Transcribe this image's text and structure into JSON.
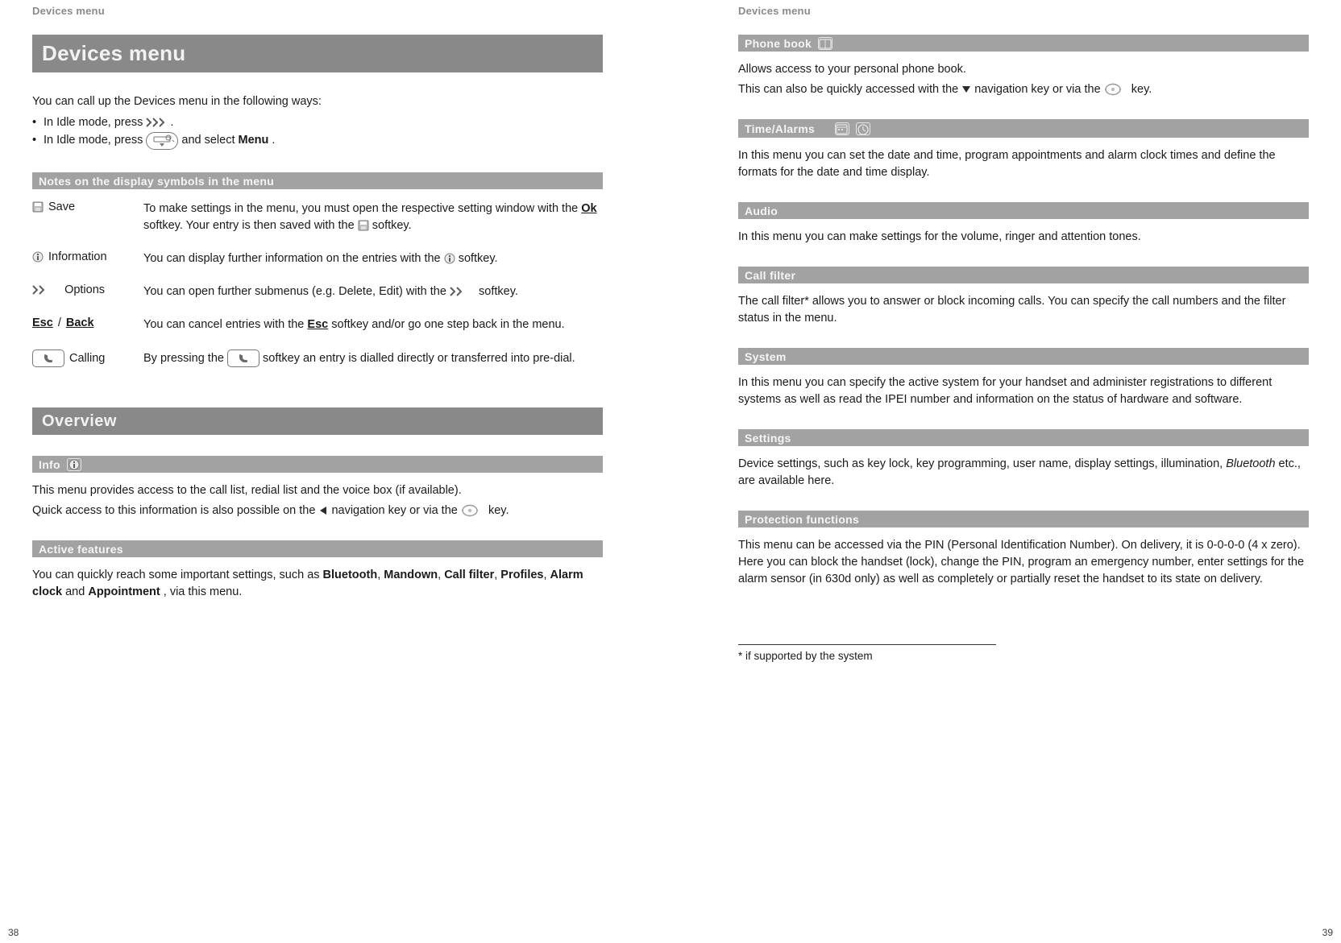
{
  "page_left": {
    "running_head": "Devices menu",
    "title": "Devices menu",
    "intro": "You can call up the Devices menu in the following ways:",
    "bullet1_a": "In Idle mode, press ",
    "bullet1_b": " .",
    "bullet2_a": "In Idle mode, press ",
    "bullet2_b": " and select ",
    "bullet2_menu": "Menu",
    "bullet2_c": ".",
    "notes_header": "Notes on the display symbols in the menu",
    "rows": {
      "save": {
        "label": "Save",
        "text_a": "To make settings in the menu, you must open the respective setting window with the ",
        "ok": "Ok",
        "text_b": " softkey. Your entry is then saved with the ",
        "text_c": " softkey."
      },
      "info": {
        "label": "Information",
        "text_a": "You can display further information on the entries with the ",
        "text_b": " softkey."
      },
      "options": {
        "label": "Options",
        "text_a": "You can open further submenus (e.g. Delete, Edit) with the ",
        "text_b": " softkey."
      },
      "esc": {
        "label_a": "Esc",
        "label_sep": " / ",
        "label_b": "Back",
        "text_a": "You can cancel entries with the ",
        "esc2": "Esc",
        "text_b": " softkey and/or go one step back in the menu."
      },
      "call": {
        "label": "Calling",
        "text_a": "By pressing the ",
        "text_b": " softkey an entry is dialled directly or transferred into pre-dial."
      }
    },
    "overview_header": "Overview",
    "info_section": {
      "title": "Info",
      "line1": "This menu provides access to the call list, redial list and the voice box (if available).",
      "line2_a": "Quick access to this information is also possible on the ",
      "line2_b": " navigation key or via the ",
      "line2_c": " key."
    },
    "active_section": {
      "title": "Active features",
      "text_a": "You can quickly reach some important settings, such as ",
      "f1": "Bluetooth",
      "c1": ", ",
      "f2": "Mandown",
      "c2": ", ",
      "f3": "Call filter",
      "c3": ", ",
      "f4": "Profiles",
      "c4": ", ",
      "f5": "Alarm clock",
      "and": " and ",
      "f6": "Appointment",
      "text_b": ", via this menu."
    },
    "page_num": "38"
  },
  "page_right": {
    "running_head": "Devices menu",
    "phone_book": {
      "title": "Phone book",
      "line1": "Allows access to your personal phone book.",
      "line2_a": "This can also be quickly accessed with the ",
      "line2_b": " navigation key or via the ",
      "line2_c": " key."
    },
    "time_alarms": {
      "title": "Time/Alarms",
      "text": "In this menu you can set the date and time, program appointments and alarm clock times and define the formats for the date and time display."
    },
    "audio": {
      "title": "Audio",
      "text": "In this menu you can make settings for the volume, ringer and attention tones."
    },
    "call_filter": {
      "title": "Call filter",
      "text": "The call filter* allows you to answer or block incoming calls. You can specify the call numbers and the filter status in the menu."
    },
    "system": {
      "title": "System",
      "text": "In this menu you can specify the active system for your handset and administer registrations to different systems as well as read the IPEI number and information on the status of hardware and software."
    },
    "settings": {
      "title": "Settings",
      "text_a": "Device settings, such as key lock, key programming, user name, display settings, illumination, ",
      "bt": "Bluetooth",
      "text_b": " etc., are available here."
    },
    "protection": {
      "title": "Protection functions",
      "text": "This menu can be accessed via the PIN (Personal Identification Number). On delivery, it is 0-0-0-0 (4 x zero). Here you can block the handset (lock), change the PIN, program an emergency number, enter settings for the alarm sensor (in 630d only) as well as completely or partially reset the handset to its state on delivery."
    },
    "footnote": "* if supported by the system",
    "page_num": "39"
  }
}
